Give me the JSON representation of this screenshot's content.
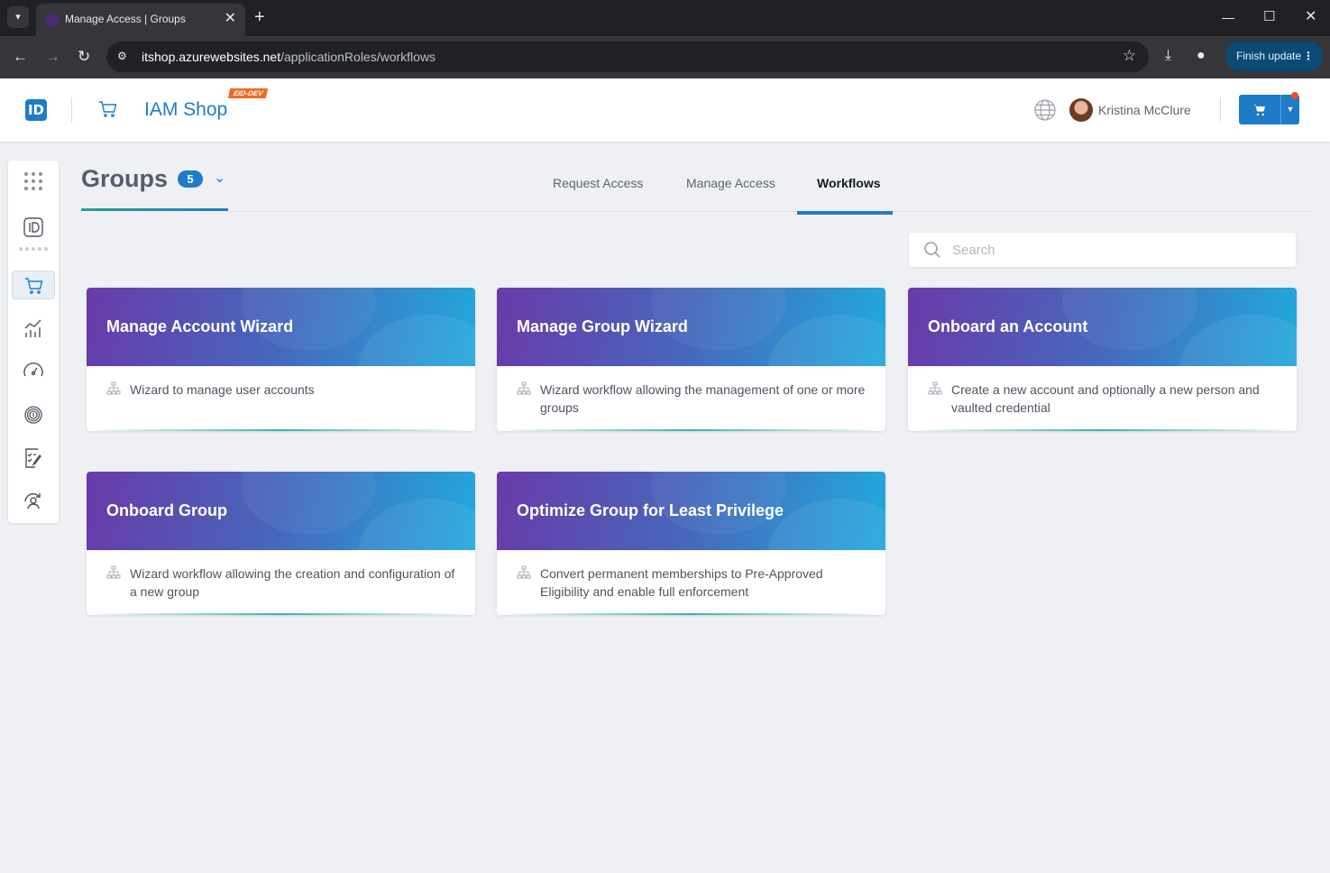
{
  "browser": {
    "tab_title": "Manage Access | Groups",
    "url_host": "itshop.azurewebsites.net",
    "url_path": "/applicationRoles/workflows",
    "finish_update_label": "Finish update"
  },
  "header": {
    "logo_text": "ID",
    "app_title": "IAM Shop",
    "env_badge": "EID-DEV",
    "user_name": "Kristina McClure"
  },
  "page": {
    "title": "Groups",
    "count": "5"
  },
  "tabs": [
    {
      "label": "Request Access",
      "active": false
    },
    {
      "label": "Manage Access",
      "active": false
    },
    {
      "label": "Workflows",
      "active": true
    }
  ],
  "search": {
    "placeholder": "Search",
    "value": ""
  },
  "workflows": [
    {
      "title": "Manage Account Wizard",
      "description": "Wizard to manage user accounts"
    },
    {
      "title": "Manage Group Wizard",
      "description": "Wizard workflow allowing the management of one or more groups"
    },
    {
      "title": "Onboard an Account",
      "description": "Create a new account and optionally a new person and vaulted credential"
    },
    {
      "title": "Onboard Group",
      "description": "Wizard workflow allowing the creation and configuration of a new group"
    },
    {
      "title": "Optimize Group for Least Privilege",
      "description": "Convert permanent memberships to Pre-Approved Eligibility and enable full enforcement"
    }
  ],
  "rail_icons": [
    "apps-grid-icon",
    "id-card-icon",
    "shopping-cart-icon",
    "analytics-chart-icon",
    "speedometer-icon",
    "fingerprint-icon",
    "checklist-icon",
    "user-sync-icon"
  ],
  "colors": {
    "accent": "#1e7bc8",
    "card_gradient_start": "#6a3aa8",
    "card_gradient_end": "#21a9dc",
    "env_badge": "#f06a23",
    "background": "#eef0f4"
  }
}
